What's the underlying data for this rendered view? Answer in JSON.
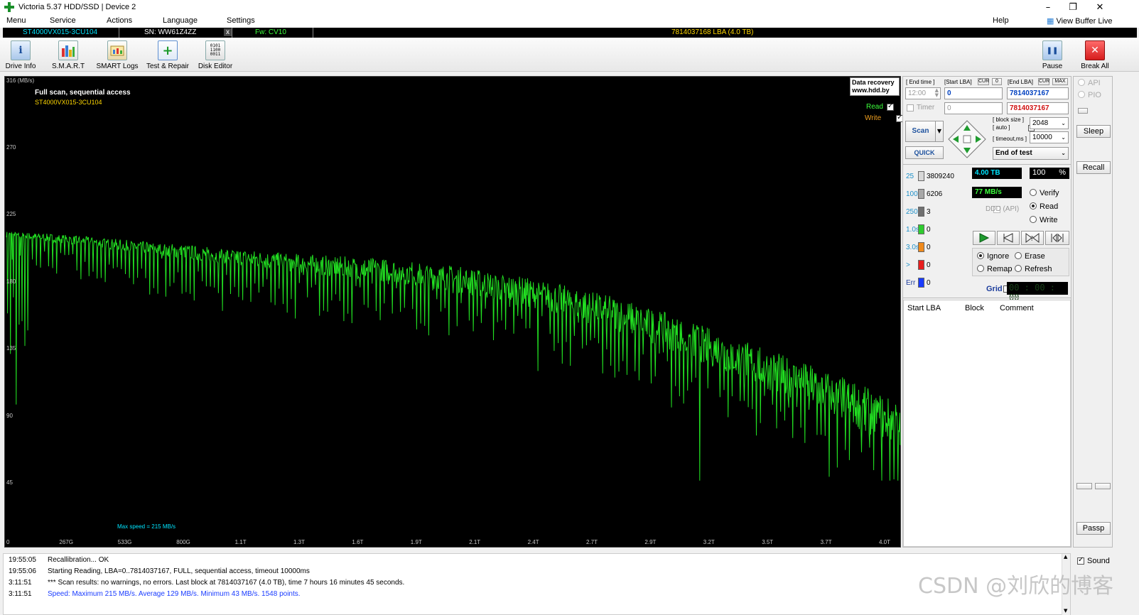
{
  "window": {
    "title": "Victoria 5.37 HDD/SSD | Device 2",
    "min_glyph": "–",
    "restore_glyph": "❐",
    "close_glyph": "✕"
  },
  "menu": {
    "items": [
      "Menu",
      "Service",
      "Actions",
      "Language",
      "Settings"
    ],
    "help": "Help",
    "view_buffer": "View Buffer Live"
  },
  "drive": {
    "model": "ST4000VX015-3CU104",
    "serial": "SN: WW61Z4ZZ",
    "close_x": "x",
    "firmware": "Fw: CV10",
    "capacity": "7814037168 LBA (4.0 TB)"
  },
  "toolbar": {
    "buttons": [
      "Drive Info",
      "S.M.A.R.T",
      "SMART Logs",
      "Test & Repair",
      "Disk Editor"
    ],
    "pause": "Pause",
    "break_all": "Break All"
  },
  "graph": {
    "unit_label": "316 (MB/s)",
    "title": "Full scan, sequential access",
    "model": "ST4000VX015-3CU104",
    "badge_line1": "Data recovery",
    "badge_line2": "www.hdd.by",
    "legend_read": "Read",
    "legend_write": "Write",
    "max_speed": "Max speed = 215 MB/s",
    "y_ticks": [
      "270",
      "225",
      "180",
      "135",
      "90",
      "45"
    ],
    "x_ticks": [
      "0",
      "267G",
      "533G",
      "800G",
      "1.1T",
      "1.3T",
      "1.6T",
      "1.9T",
      "2.1T",
      "2.4T",
      "2.7T",
      "2.9T",
      "3.2T",
      "3.5T",
      "3.7T",
      "4.0T"
    ]
  },
  "chart_data": {
    "type": "line",
    "ylabel": "(MB/s)",
    "ylim": [
      0,
      316
    ],
    "xlim_tb": [
      0,
      4.0
    ],
    "series": [
      {
        "name": "Read",
        "x_tb": [
          0,
          0.25,
          0.5,
          0.75,
          1.0,
          1.25,
          1.5,
          1.75,
          2.0,
          2.25,
          2.5,
          2.75,
          3.0,
          3.25,
          3.5,
          3.75,
          4.0
        ],
        "values": [
          210,
          207,
          203,
          199,
          195,
          191,
          188,
          185,
          180,
          173,
          165,
          155,
          142,
          128,
          113,
          98,
          80
        ]
      }
    ],
    "maximum": 215,
    "average": 129,
    "minimum": 43,
    "points": 1548
  },
  "params": {
    "end_time_hdr": "[ End time ]",
    "start_lba_hdr": "[Start LBA]",
    "cur": "CUR",
    "zero": "0",
    "end_lba_hdr": "[End LBA]",
    "max": "MAX",
    "end_time": "12:00",
    "start_lba": "0",
    "end_lba": "7814037167",
    "timer_label": "Timer",
    "timer_value": "0",
    "end_lba2": "7814037167",
    "scan": "Scan",
    "quick": "QUICK",
    "block_size_hdr": "[ block size ]",
    "auto_hdr": "[ auto ]",
    "timeout_hdr": "[ timeout,ms ]",
    "block_size": "2048",
    "timeout": "10000",
    "end_action": "End of test"
  },
  "blocks": [
    {
      "label": "25",
      "color": "#d8d8d8",
      "count": "3809240"
    },
    {
      "label": "100",
      "color": "#a8a8a8",
      "count": "6206"
    },
    {
      "label": "250",
      "color": "#707070",
      "count": "3"
    },
    {
      "label": "1.0s",
      "color": "#2ecc2e",
      "count": "0"
    },
    {
      "label": "3.0s",
      "color": "#f08a1c",
      "count": "0"
    },
    {
      "label": ">",
      "color": "#e81e1e",
      "count": "0"
    },
    {
      "label": "Err",
      "color": "#1a3cff",
      "count": "0"
    }
  ],
  "progress": {
    "size": "4.00 TB",
    "percent": "100",
    "pct_sign": "%",
    "speed": "77 MB/s",
    "ddd": "DDD (API)"
  },
  "modes": {
    "verify": "Verify",
    "read": "Read",
    "write": "Write"
  },
  "actions": {
    "ignore": "Ignore",
    "erase": "Erase",
    "remap": "Remap",
    "refresh": "Refresh"
  },
  "grid": {
    "label": "Grid",
    "clock": "00 : 00 : 00"
  },
  "table": {
    "headers": [
      "Start LBA",
      "Block",
      "Comment"
    ]
  },
  "side": {
    "api": "API",
    "pio": "PIO",
    "sleep": "Sleep",
    "recall": "Recall",
    "passp": "Passp",
    "sound": "Sound"
  },
  "log": [
    {
      "time": "19:55:05",
      "msg": "Recallibration... OK",
      "color": "#000000"
    },
    {
      "time": "19:55:06",
      "msg": "Starting Reading, LBA=0..7814037167, FULL, sequential access, timeout 10000ms",
      "color": "#000000"
    },
    {
      "time": "3:11:51",
      "msg": "*** Scan results: no warnings, no errors. Last block at 7814037167 (4.0 TB), time 7 hours 16 minutes 45 seconds.",
      "color": "#000000"
    },
    {
      "time": "3:11:51",
      "msg": "Speed: Maximum 215 MB/s. Average 129 MB/s. Minimum 43 MB/s. 1548 points.",
      "color": "#1a3cff"
    }
  ],
  "watermark": "CSDN @刘欣的博客"
}
